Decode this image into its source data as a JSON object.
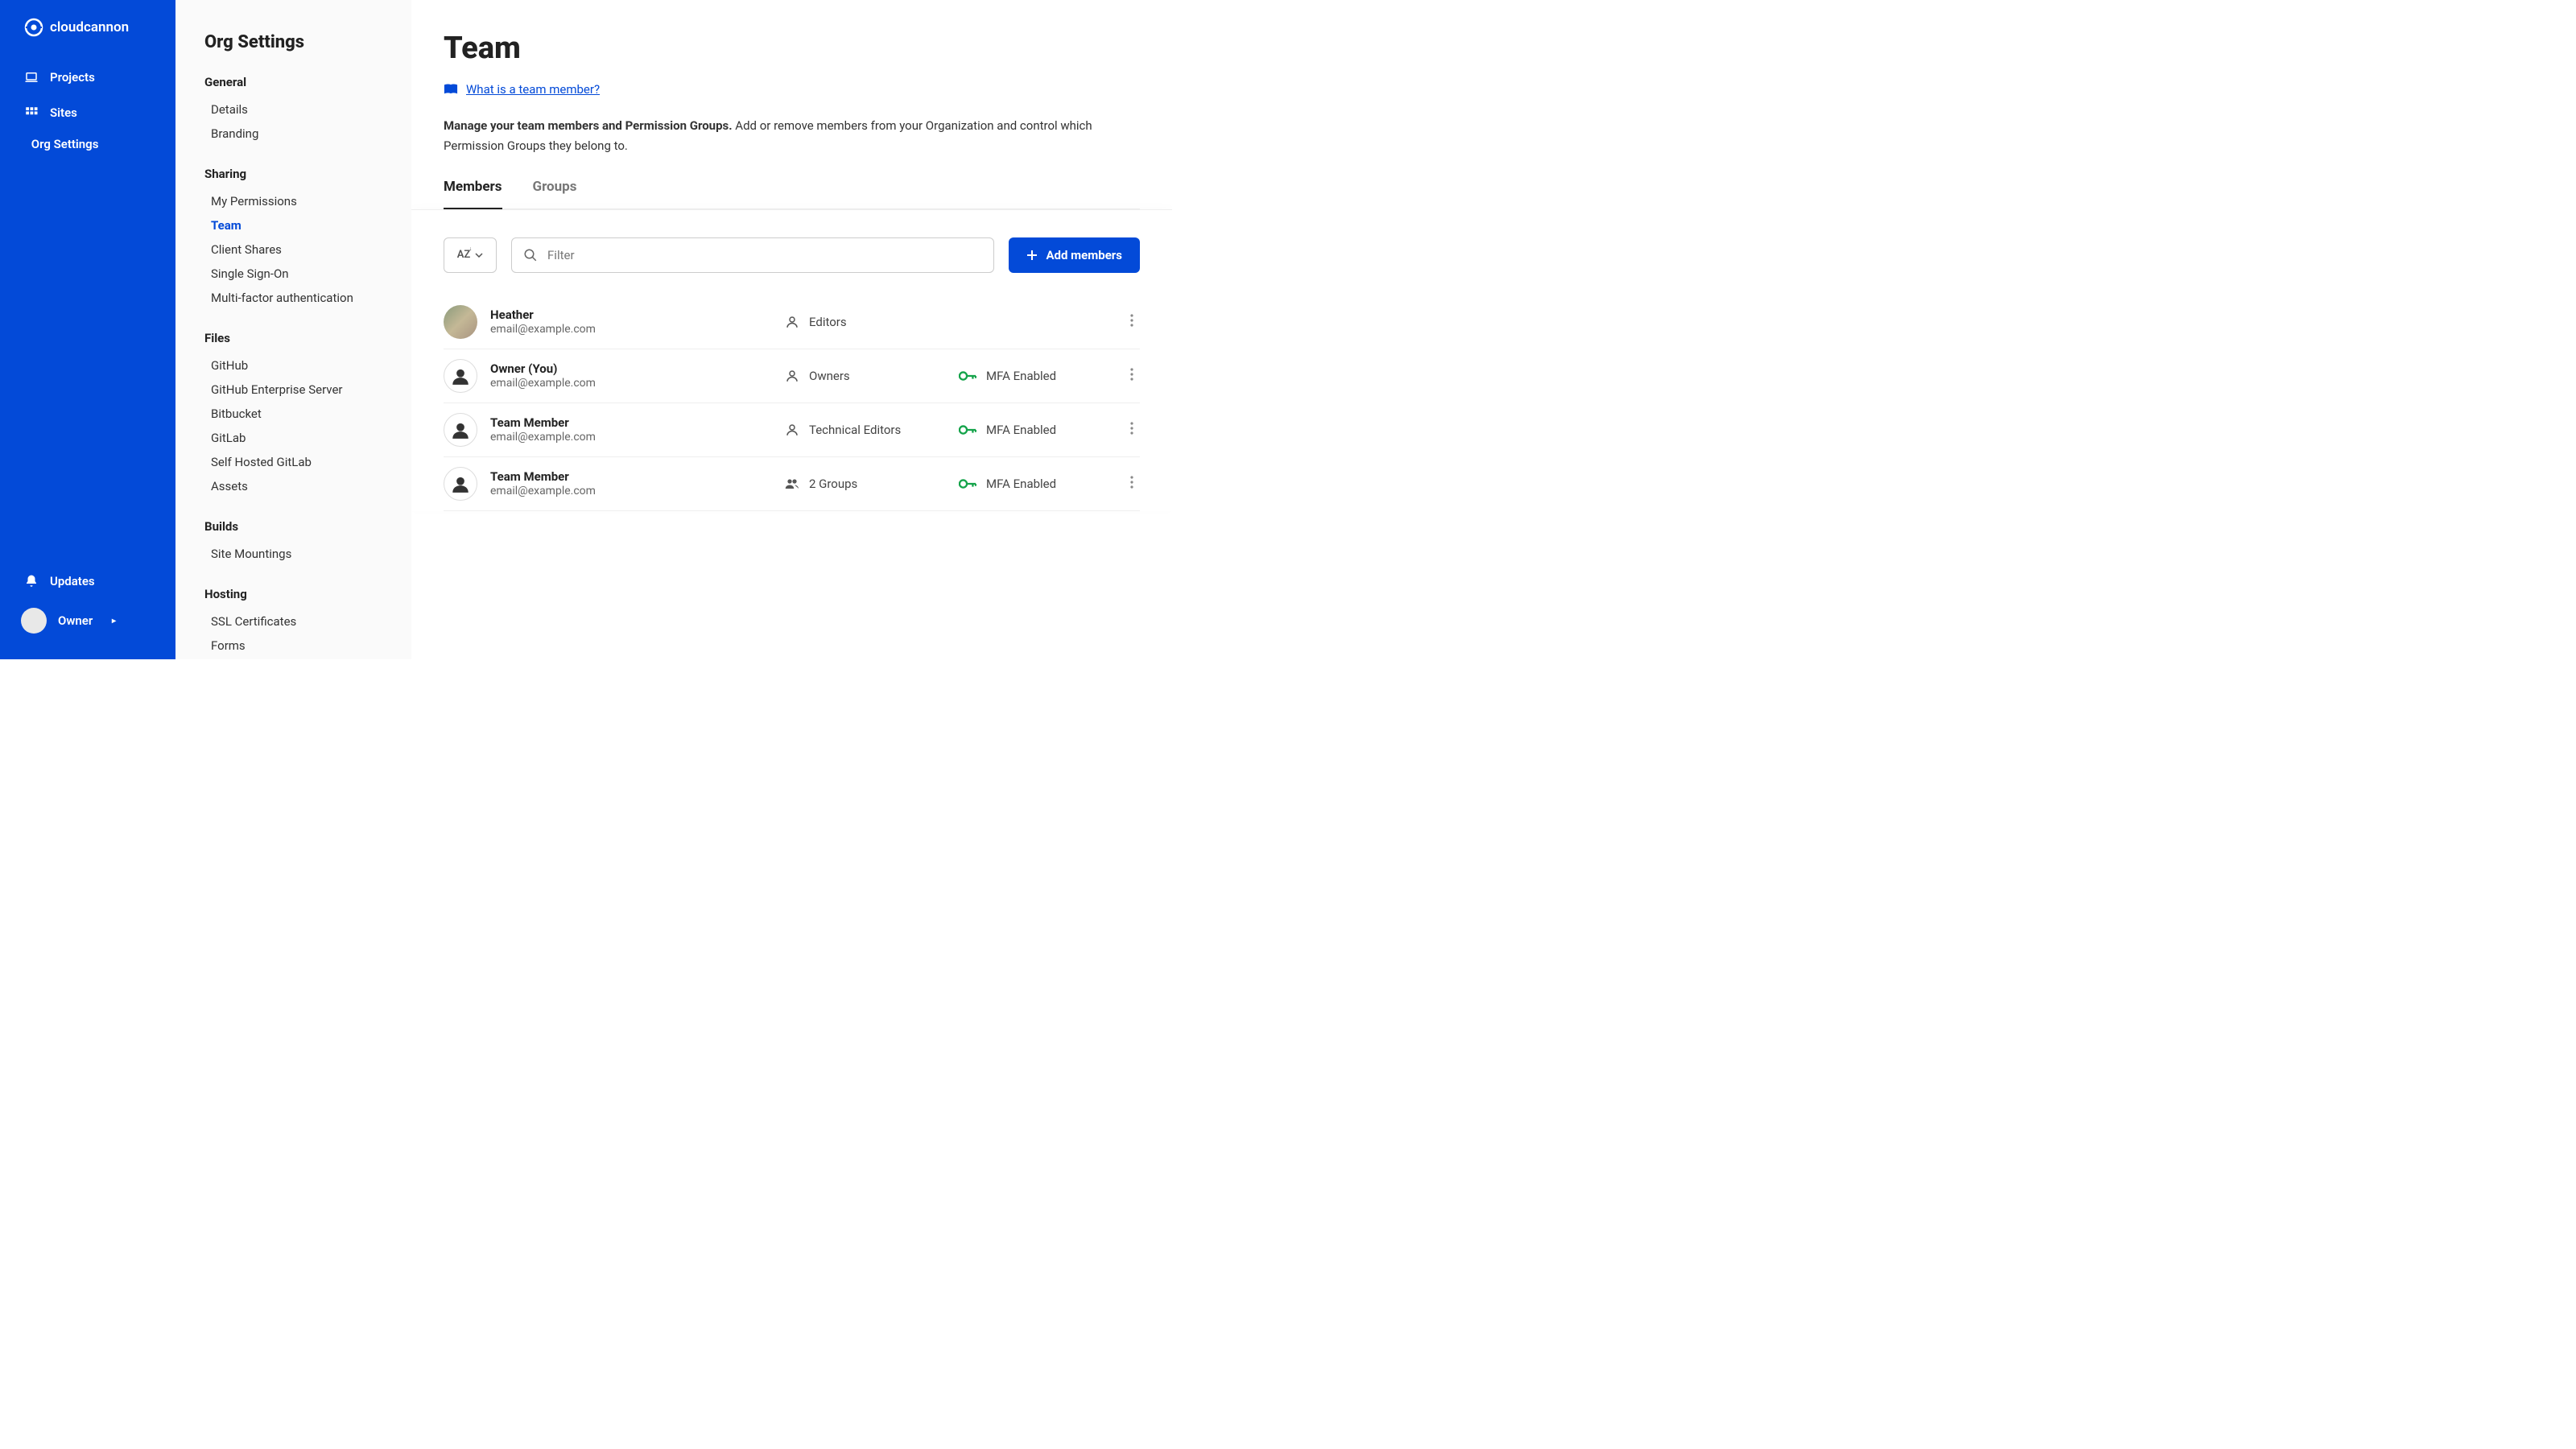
{
  "brand": "cloudcannon",
  "primaryNav": {
    "projects": "Projects",
    "sites": "Sites",
    "orgSettings": "Org Settings",
    "updates": "Updates",
    "userLabel": "Owner"
  },
  "secondaryNav": {
    "title": "Org Settings",
    "sections": {
      "general": {
        "label": "General",
        "details": "Details",
        "branding": "Branding"
      },
      "sharing": {
        "label": "Sharing",
        "myPerms": "My Permissions",
        "team": "Team",
        "clientShares": "Client Shares",
        "sso": "Single Sign-On",
        "mfa": "Multi-factor authentication"
      },
      "files": {
        "label": "Files",
        "github": "GitHub",
        "ghes": "GitHub Enterprise Server",
        "bitbucket": "Bitbucket",
        "gitlab": "GitLab",
        "selfGitlab": "Self Hosted GitLab",
        "assets": "Assets"
      },
      "builds": {
        "label": "Builds",
        "mountings": "Site Mountings"
      },
      "hosting": {
        "label": "Hosting",
        "ssl": "SSL Certificates",
        "forms": "Forms"
      }
    }
  },
  "page": {
    "title": "Team",
    "helpLink": "What is a team member?",
    "descBold": "Manage your team members and Permission Groups.",
    "descRest": " Add or remove members from your Organization and control which Permission Groups they belong to.",
    "tabs": {
      "members": "Members",
      "groups": "Groups"
    }
  },
  "controls": {
    "sortLabel": "AZ",
    "filterPlaceholder": "Filter",
    "addLabel": "Add members"
  },
  "members": [
    {
      "name": "Heather",
      "email": "email@example.com",
      "group": "Editors",
      "groupIcon": "person",
      "mfa": false,
      "photo": true
    },
    {
      "name": "Owner (You)",
      "email": "email@example.com",
      "group": "Owners",
      "groupIcon": "person",
      "mfa": true,
      "photo": false
    },
    {
      "name": "Team Member",
      "email": "email@example.com",
      "group": "Technical Editors",
      "groupIcon": "person",
      "mfa": true,
      "photo": false
    },
    {
      "name": "Team Member",
      "email": "email@example.com",
      "group": "2 Groups",
      "groupIcon": "people",
      "mfa": true,
      "photo": false
    }
  ],
  "mfaLabel": "MFA Enabled"
}
